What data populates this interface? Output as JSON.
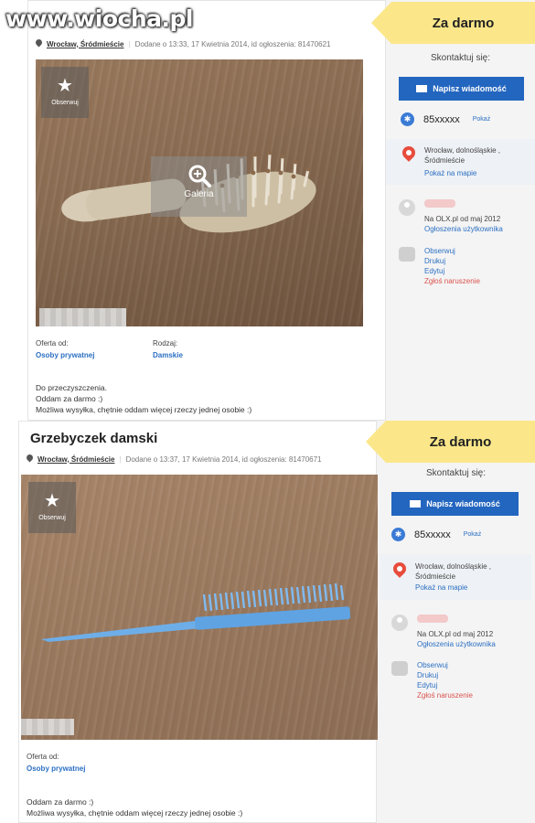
{
  "watermark": "www.wiocha.pl",
  "ads": [
    {
      "title": "",
      "location": "Wrocław, Śródmieście",
      "added": "Dodane o 13:33, 17 Kwietnia 2014, id ogłoszenia: 81470621",
      "observe": "Obserwuj",
      "gallery": "Galeria",
      "offer_label": "Oferta od:",
      "offer_value": "Osoby prywatnej",
      "type_label": "Rodzaj:",
      "type_value": "Damskie",
      "desc": [
        "Do przeczyszczenia.",
        "Oddam za darmo :)",
        "Możliwa wysyłka, chętnie oddam więcej rzeczy jednej osobie :)"
      ],
      "price": "Za darmo",
      "contact": "Skontaktuj się:",
      "message_button": "Napisz wiadomość",
      "phone": "85xxxxx",
      "show": "Pokaż",
      "city": "Wrocław, dolnośląskie ,",
      "district": "Śródmieście",
      "map_link": "Pokaż na mapie",
      "since": "Na OLX.pl od maj 2012",
      "user_ads": "Ogłoszenia użytkownika",
      "actions": [
        "Obserwuj",
        "Drukuj",
        "Edytuj",
        "Zgłoś naruszenie"
      ]
    },
    {
      "title": "Grzebyczek damski",
      "location": "Wrocław, Śródmieście",
      "added": "Dodane o 13:37, 17 Kwietnia 2014, id ogłoszenia: 81470671",
      "observe": "Obserwuj",
      "offer_label": "Oferta od:",
      "offer_value": "Osoby prywatnej",
      "desc": [
        "Oddam za darmo :)",
        "Możliwa wysyłka, chętnie oddam więcej rzeczy jednej osobie :)"
      ],
      "price": "Za darmo",
      "contact": "Skontaktuj się:",
      "message_button": "Napisz wiadomość",
      "phone": "85xxxxx",
      "show": "Pokaż",
      "city": "Wrocław, dolnośląskie ,",
      "district": "Śródmieście",
      "map_link": "Pokaż na mapie",
      "since": "Na OLX.pl od maj 2012",
      "user_ads": "Ogłoszenia użytkownika",
      "actions": [
        "Obserwuj",
        "Drukuj",
        "Edytuj",
        "Zgłoś naruszenie"
      ]
    }
  ],
  "colors": {
    "accent_blue": "#2366bf",
    "price_yellow": "#fbe78a",
    "link_blue": "#2b6fc2",
    "report_red": "#d9534f"
  }
}
